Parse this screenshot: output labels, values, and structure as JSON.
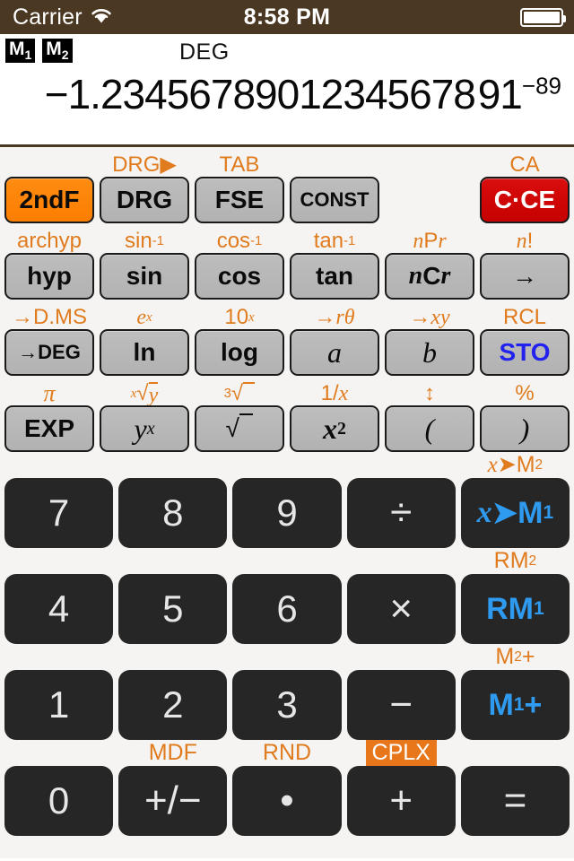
{
  "statusbar": {
    "carrier": "Carrier",
    "wifi_icon": "wifi-icon",
    "time": "8:58 PM",
    "battery_icon": "battery-full-icon"
  },
  "display": {
    "memory_indicators": [
      {
        "label": "M",
        "sub": "1"
      },
      {
        "label": "M",
        "sub": "2"
      }
    ],
    "angle_mode": "DEG",
    "value_mantissa": "−1.23456789012345678 91",
    "value_exponent": "−89"
  },
  "function_rows": [
    {
      "keys": [
        {
          "alt": "",
          "label": "2ndF",
          "style": "orange",
          "name": "second-function"
        },
        {
          "alt": "DRG▶",
          "label": "DRG",
          "style": "gray",
          "name": "drg"
        },
        {
          "alt": "TAB",
          "label": "FSE",
          "style": "gray",
          "name": "fse"
        },
        {
          "alt": "",
          "label": "CONST",
          "style": "gray",
          "name": "const"
        },
        {
          "alt": "",
          "label": "",
          "style": "spacer",
          "name": "spacer"
        },
        {
          "alt": "CA",
          "label": "C·CE",
          "style": "red",
          "name": "clear"
        }
      ]
    },
    {
      "keys": [
        {
          "alt": "archyp",
          "label": "hyp",
          "style": "gray",
          "name": "hyp"
        },
        {
          "alt": "sin-1",
          "label": "sin",
          "style": "gray",
          "name": "sin"
        },
        {
          "alt": "cos-1",
          "label": "cos",
          "style": "gray",
          "name": "cos"
        },
        {
          "alt": "tan-1",
          "label": "tan",
          "style": "gray",
          "name": "tan"
        },
        {
          "alt": "nPr",
          "label": "nCr",
          "style": "gray",
          "name": "ncr"
        },
        {
          "alt": "n!",
          "label": "→",
          "style": "gray",
          "name": "right-arrow"
        }
      ]
    },
    {
      "keys": [
        {
          "alt": "→D.MS",
          "label": "→DEG",
          "style": "gray",
          "name": "to-deg"
        },
        {
          "alt": "ex",
          "label": "ln",
          "style": "gray",
          "name": "ln"
        },
        {
          "alt": "10x",
          "label": "log",
          "style": "gray",
          "name": "log"
        },
        {
          "alt": "→rθ",
          "label": "a",
          "style": "gray",
          "name": "a"
        },
        {
          "alt": "→xy",
          "label": "b",
          "style": "gray",
          "name": "b"
        },
        {
          "alt": "RCL",
          "label": "STO",
          "style": "gray",
          "name": "sto"
        }
      ]
    },
    {
      "keys": [
        {
          "alt": "π",
          "label": "EXP",
          "style": "gray",
          "name": "exp"
        },
        {
          "alt": "x-root-y",
          "label": "yx",
          "style": "gray",
          "name": "y-to-x"
        },
        {
          "alt": "cbrt",
          "label": "sqrt",
          "style": "gray",
          "name": "sqrt"
        },
        {
          "alt": "1/x",
          "label": "x2",
          "style": "gray",
          "name": "x-squared"
        },
        {
          "alt": "↕",
          "label": "(",
          "style": "gray",
          "name": "open-paren"
        },
        {
          "alt": "%",
          "label": ")",
          "style": "gray",
          "name": "close-paren"
        }
      ]
    }
  ],
  "number_rows": [
    {
      "keys": [
        {
          "alt": "",
          "label": "7",
          "name": "digit-7",
          "style": "num"
        },
        {
          "alt": "",
          "label": "8",
          "name": "digit-8",
          "style": "num"
        },
        {
          "alt": "",
          "label": "9",
          "name": "digit-9",
          "style": "num"
        },
        {
          "alt": "",
          "label": "÷",
          "name": "divide",
          "style": "num"
        },
        {
          "alt": "x→M2",
          "label": "x→M1",
          "name": "store-m1",
          "style": "mem"
        }
      ]
    },
    {
      "keys": [
        {
          "alt": "",
          "label": "4",
          "name": "digit-4",
          "style": "num"
        },
        {
          "alt": "",
          "label": "5",
          "name": "digit-5",
          "style": "num"
        },
        {
          "alt": "",
          "label": "6",
          "name": "digit-6",
          "style": "num"
        },
        {
          "alt": "",
          "label": "×",
          "name": "multiply",
          "style": "num"
        },
        {
          "alt": "RM2",
          "label": "RM1",
          "name": "recall-m1",
          "style": "mem"
        }
      ]
    },
    {
      "keys": [
        {
          "alt": "",
          "label": "1",
          "name": "digit-1",
          "style": "num"
        },
        {
          "alt": "",
          "label": "2",
          "name": "digit-2",
          "style": "num"
        },
        {
          "alt": "",
          "label": "3",
          "name": "digit-3",
          "style": "num"
        },
        {
          "alt": "",
          "label": "−",
          "name": "subtract",
          "style": "num"
        },
        {
          "alt": "M2+",
          "label": "M1+",
          "name": "add-m1",
          "style": "mem"
        }
      ]
    },
    {
      "keys": [
        {
          "alt": "",
          "label": "0",
          "name": "digit-0",
          "style": "num"
        },
        {
          "alt": "MDF",
          "label": "+/−",
          "name": "sign-toggle",
          "style": "num"
        },
        {
          "alt": "RND",
          "label": "•",
          "name": "decimal-point",
          "style": "num"
        },
        {
          "alt": "CPLX",
          "label": "+",
          "name": "add",
          "style": "num",
          "alt_boxed": true
        },
        {
          "alt": "",
          "label": "=",
          "name": "equals",
          "style": "num"
        }
      ]
    }
  ],
  "colors": {
    "status_bar": "#4a3823",
    "panel": "#f5f4f2",
    "alt_label": "#e07b1e",
    "second_function": "#fb7e00",
    "clear_key": "#c60000",
    "memory_key_text": "#2e9bf0",
    "sto_text": "#2222ee",
    "function_key": "#b7b7b7",
    "number_key": "#262626"
  }
}
